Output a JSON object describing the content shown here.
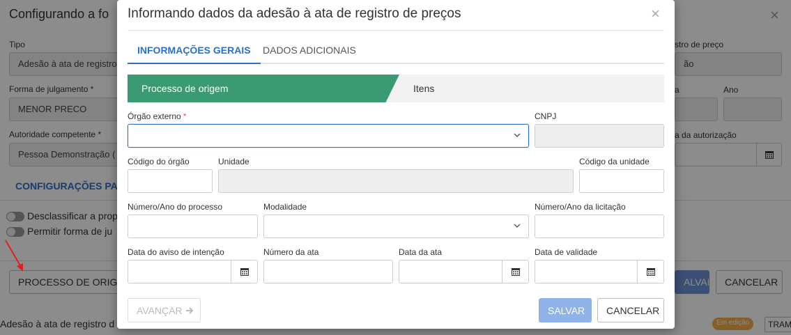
{
  "background": {
    "title": "Configurando a fo",
    "labels": {
      "tipo": "Tipo",
      "forma_julgamento": "Forma de julgamento",
      "autoridade": "Autoridade competente",
      "registro_preco": "stro de preço",
      "ano_short": "a",
      "ano": "Ano",
      "data_autorizacao": "a da autorização",
      "req": "*"
    },
    "values": {
      "tipo": "Adesão à ata de registro",
      "forma_julgamento": "MENOR PRECO",
      "autoridade": "Pessoa Demonstração (",
      "registro_preco": "ão"
    },
    "tab": "CONFIGURAÇÕES PAR",
    "toggles": [
      "Desclassificar a prop",
      "Permitir forma de ju"
    ],
    "buttons": {
      "processo_origem": "PROCESSO DE ORIGEM",
      "salvar": "ALVAR",
      "cancelar": "CANCELAR"
    },
    "footer_text": "Adesão à ata de registro d",
    "badge": "Em edição",
    "tram": "TRAM"
  },
  "dialog": {
    "title": "Informando dados da adesão à ata de registro de preços",
    "close": "×",
    "tabs": [
      "INFORMAÇÕES GERAIS",
      "DADOS ADICIONAIS"
    ],
    "steps": [
      "Processo de origem",
      "Itens"
    ],
    "fields": {
      "orgao_externo": {
        "label": "Órgão externo",
        "required": "*",
        "value": ""
      },
      "cnpj": {
        "label": "CNPJ",
        "value": ""
      },
      "codigo_orgao": {
        "label": "Código do órgão",
        "value": ""
      },
      "unidade": {
        "label": "Unidade",
        "value": ""
      },
      "codigo_unidade": {
        "label": "Código da unidade",
        "value": ""
      },
      "numero_ano_processo": {
        "label": "Número/Ano do processo",
        "value": ""
      },
      "modalidade": {
        "label": "Modalidade",
        "value": ""
      },
      "numero_ano_licitacao": {
        "label": "Número/Ano da licitação",
        "value": ""
      },
      "data_aviso": {
        "label": "Data do aviso de intenção",
        "value": ""
      },
      "numero_ata": {
        "label": "Número da ata",
        "value": ""
      },
      "data_ata": {
        "label": "Data da ata",
        "value": ""
      },
      "data_validade": {
        "label": "Data de validade",
        "value": ""
      }
    },
    "buttons": {
      "avancar": "AVANÇAR",
      "salvar": "SALVAR",
      "cancelar": "CANCELAR"
    }
  },
  "colors": {
    "accent": "#2a6fc9",
    "step_active": "#3a9b73",
    "primary_button": "#8fb3e8",
    "required": "#d9534f",
    "annotation_arrow": "#e02020"
  }
}
